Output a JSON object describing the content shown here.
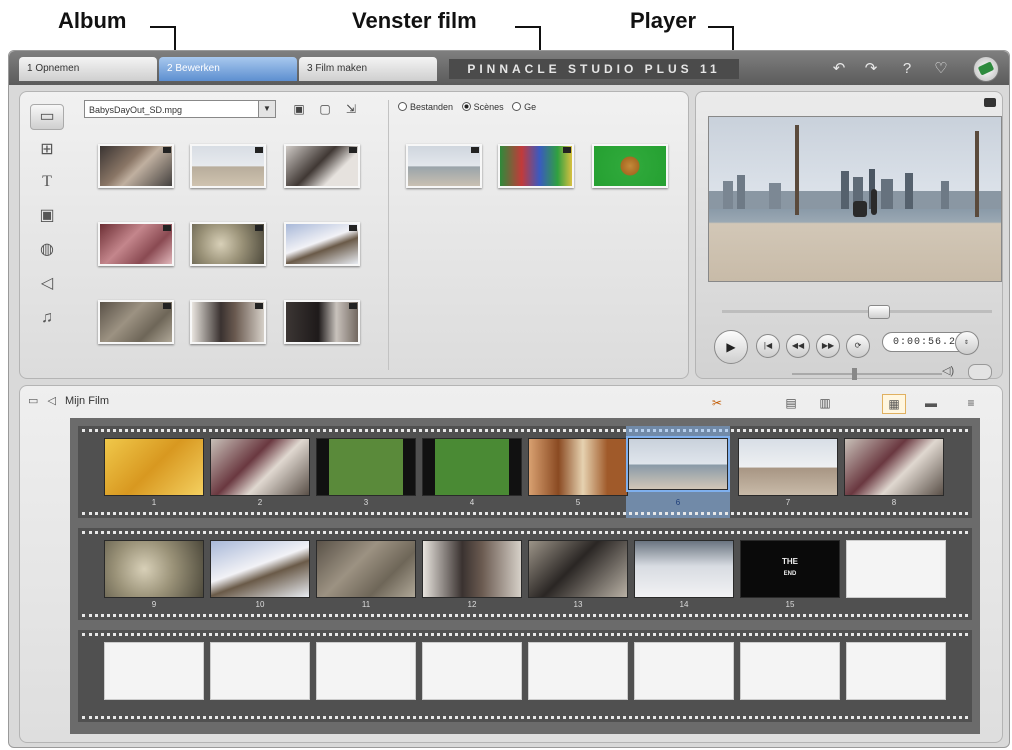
{
  "callouts": {
    "album": "Album",
    "film": "Venster film",
    "player": "Player"
  },
  "tabs": [
    {
      "label": "1 Opnemen"
    },
    {
      "label": "2 Bewerken"
    },
    {
      "label": "3 Film maken"
    }
  ],
  "brand": "PINNACLE STUDIO PLUS 11",
  "toolbar_icons": [
    "undo-icon",
    "redo-icon",
    "help-icon",
    "hint-icon",
    "logo-icon"
  ],
  "album": {
    "file": "BabysDayOut_SD.mpg",
    "tools": [
      "video-scene-icon",
      "folder-icon",
      "import-icon"
    ],
    "radios": {
      "files": "Bestanden",
      "scenes": "Scènes",
      "third": "Ge"
    },
    "side_icons": [
      "video-tab-icon",
      "transitions-icon",
      "titles-icon",
      "photos-icon",
      "discmenu-icon",
      "sound-icon",
      "music-icon"
    ]
  },
  "player": {
    "timecode": "0:00:56.23"
  },
  "movie": {
    "title": "Mijn Film",
    "tools": [
      "razor-icon",
      "properties-icon",
      "trash-icon",
      "storyboard-view-icon",
      "timeline-view-icon",
      "text-view-icon"
    ]
  },
  "film_rows": [
    [
      "1",
      "2",
      "3",
      "4",
      "5",
      "6",
      "7",
      "8"
    ],
    [
      "9",
      "10",
      "11",
      "12",
      "13",
      "14",
      "15",
      ""
    ],
    [
      "",
      "",
      "",
      "",
      "",
      "",
      "",
      ""
    ]
  ],
  "title_clip": {
    "line1": "THE",
    "line2": "END"
  },
  "colors": {
    "accent": "#5d8fd0",
    "selection": "#8cb9f0"
  }
}
